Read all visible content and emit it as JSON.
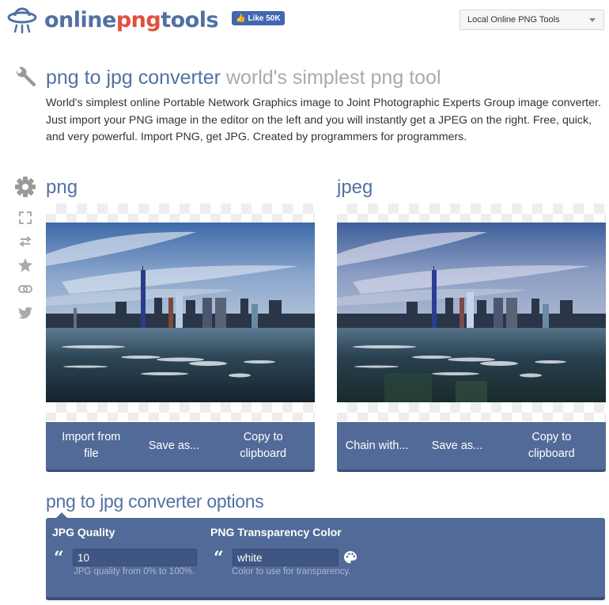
{
  "header": {
    "logo": {
      "part1": "online",
      "part2": "png",
      "part3": "tools"
    },
    "fb_like": {
      "label": "Like 50K",
      "icon": "thumbs-up-icon"
    },
    "tools_select": {
      "selected": "Local Online PNG Tools"
    }
  },
  "title": {
    "main": "png to jpg converter",
    "sub": "world's simplest png tool",
    "icon": "wrench-icon"
  },
  "description": "World's simplest online Portable Network Graphics image to Joint Photographic Experts Group image converter. Just import your PNG image in the editor on the left and you will instantly get a JPEG on the right. Free, quick, and very powerful. Import PNG, get JPG. Created by programmers for programmers.",
  "side_toolbar": [
    {
      "icon": "gear-icon",
      "label": "settings"
    },
    {
      "icon": "fullscreen-icon",
      "label": "fullscreen"
    },
    {
      "icon": "swap-icon",
      "label": "swap"
    },
    {
      "icon": "star-icon",
      "label": "favorite"
    },
    {
      "icon": "link-icon",
      "label": "link"
    },
    {
      "icon": "twitter-icon",
      "label": "twitter"
    }
  ],
  "input_editor": {
    "label": "png",
    "buttons": [
      "Import from file",
      "Save as...",
      "Copy to clipboard"
    ]
  },
  "output_editor": {
    "label": "jpeg",
    "buttons": [
      "Chain with...",
      "Save as...",
      "Copy to clipboard"
    ]
  },
  "options": {
    "title": "png to jpg converter options",
    "jpg_quality": {
      "label": "JPG Quality",
      "value": "10",
      "hint": "JPG quality from 0% to 100%."
    },
    "transparency_color": {
      "label": "PNG Transparency Color",
      "value": "white",
      "hint": "Color to use for transparency."
    }
  },
  "colors": {
    "brand_blue": "#5171a5",
    "brand_red": "#e0503c",
    "panel": "#526a97",
    "panel_dark": "#3c4f74"
  }
}
